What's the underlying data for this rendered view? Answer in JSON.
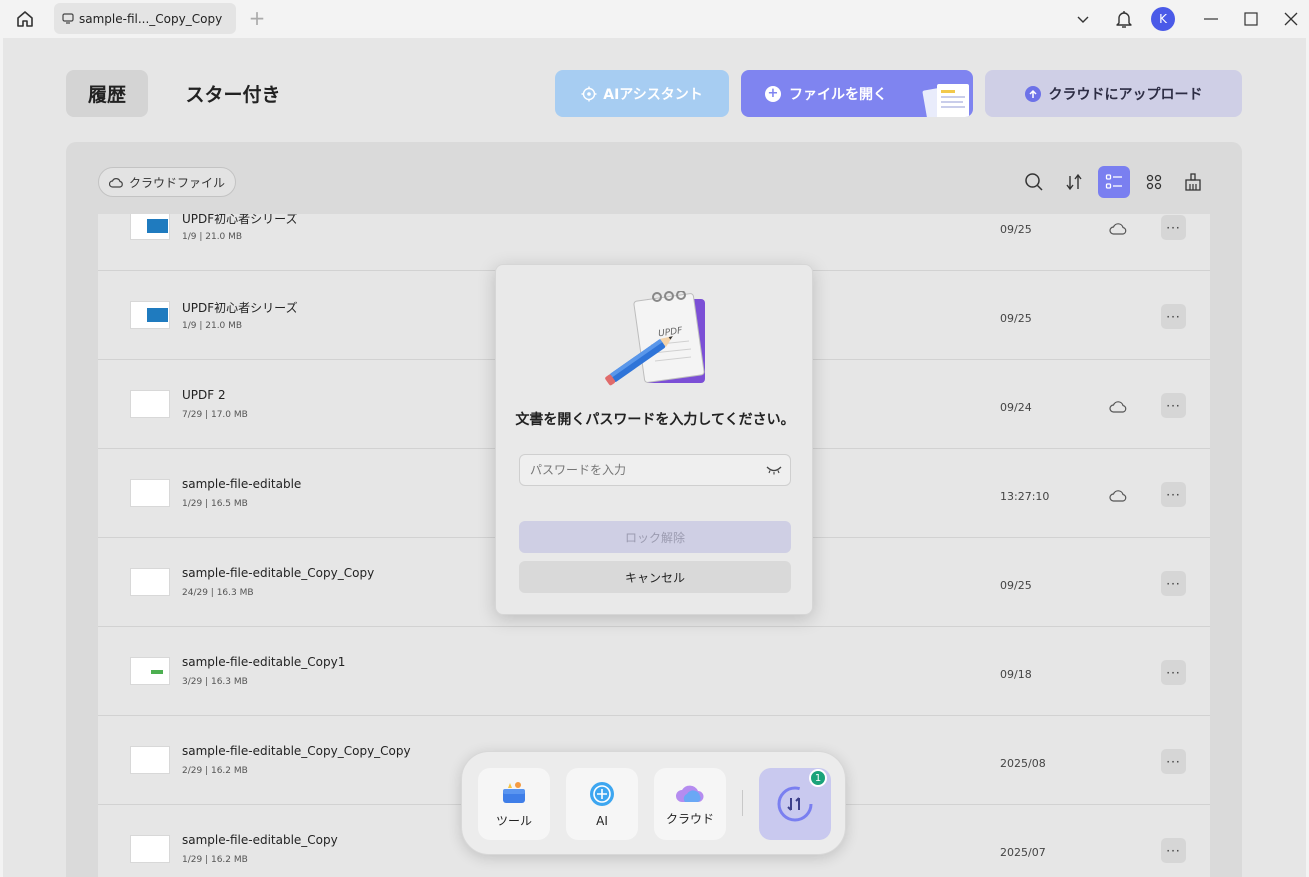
{
  "titlebar": {
    "tab_title": "sample-fil..._Copy_Copy",
    "add_tab_symbol": "+",
    "avatar_initial": "K"
  },
  "header": {
    "history_tab": "履歴",
    "starred_tab": "スター付き",
    "ai_assistant_label": "AIアシスタント",
    "open_file_label": "ファイルを開く",
    "upload_cloud_label": "クラウドにアップロード"
  },
  "toolbar": {
    "cloud_files_label": "クラウドファイル"
  },
  "files": [
    {
      "name": "UPDF初心者シリーズ",
      "meta": "1/9 | 21.0 MB",
      "date": "09/25",
      "cloud": true,
      "more": "···"
    },
    {
      "name": "UPDF初心者シリーズ",
      "meta": "1/9 | 21.0 MB",
      "date": "09/25",
      "cloud": false,
      "more": "···"
    },
    {
      "name": "UPDF 2",
      "meta": "7/29 | 17.0 MB",
      "date": "09/24",
      "cloud": true,
      "more": "···"
    },
    {
      "name": "sample-file-editable",
      "meta": "1/29 | 16.5 MB",
      "date": "13:27:10",
      "cloud": true,
      "more": "···"
    },
    {
      "name": "sample-file-editable_Copy_Copy",
      "meta": "24/29 | 16.3 MB",
      "date": "09/25",
      "cloud": false,
      "more": "···"
    },
    {
      "name": "sample-file-editable_Copy1",
      "meta": "3/29 | 16.3 MB",
      "date": "09/18",
      "cloud": false,
      "more": "···"
    },
    {
      "name": "sample-file-editable_Copy_Copy_Copy",
      "meta": "2/29 | 16.2 MB",
      "date": "2025/08",
      "cloud": false,
      "more": "···"
    },
    {
      "name": "sample-file-editable_Copy",
      "meta": "1/29 | 16.2 MB",
      "date": "2025/07",
      "cloud": false,
      "more": "···"
    }
  ],
  "modal": {
    "title": "文書を開くパスワードを入力してください。",
    "illustration_text": "UPDF",
    "password_placeholder": "パスワードを入力",
    "password_value": "",
    "unlock_label": "ロック解除",
    "cancel_label": "キャンセル"
  },
  "dock": {
    "tools_label": "ツール",
    "ai_label": "AI",
    "cloud_label": "クラウド",
    "sync_badge": "1"
  },
  "colors": {
    "accent": "#7a7ff0",
    "ai_button": "#a7cdf2",
    "upload_button": "#cfcfe6",
    "badge": "#1aa37a"
  }
}
